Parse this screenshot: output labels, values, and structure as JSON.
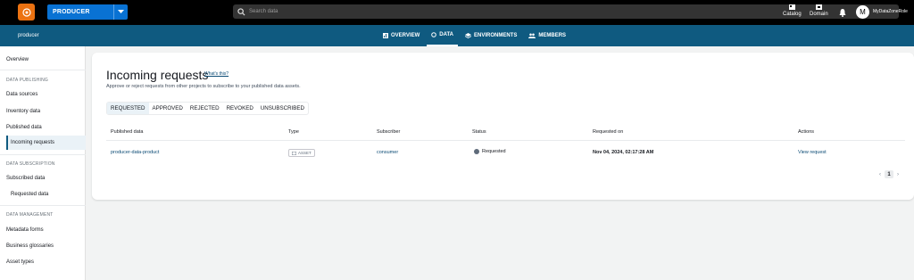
{
  "topbar": {
    "project": "PRODUCER",
    "search_placeholder": "Search data",
    "catalog_label": "Catalog",
    "domain_label": "Domain",
    "avatar_initial": "M",
    "role": "MyDataZoneRole"
  },
  "navbar": {
    "breadcrumb": "producer",
    "tabs": [
      {
        "label": "OVERVIEW",
        "icon": "overview-icon"
      },
      {
        "label": "DATA",
        "icon": "data-icon",
        "active": true
      },
      {
        "label": "ENVIRONMENTS",
        "icon": "environments-icon"
      },
      {
        "label": "MEMBERS",
        "icon": "members-icon"
      }
    ]
  },
  "sidebar": {
    "overview": "Overview",
    "section_publishing": "DATA PUBLISHING",
    "data_sources": "Data sources",
    "inventory": "Inventory data",
    "published": "Published data",
    "incoming": "Incoming requests",
    "section_subscription": "DATA SUBSCRIPTION",
    "subscribed": "Subscribed data",
    "requested": "Requested data",
    "section_management": "DATA MANAGEMENT",
    "metadata_forms": "Metadata forms",
    "glossaries": "Business glossaries",
    "asset_types": "Asset types"
  },
  "main": {
    "title": "Incoming requests",
    "whats_this": "What's this?",
    "description": "Approve or reject requests from other projects to subscribe to your published data assets.",
    "filters": [
      "REQUESTED",
      "APPROVED",
      "REJECTED",
      "REVOKED",
      "UNSUBSCRIBED"
    ],
    "columns": [
      "Published data",
      "Type",
      "Subscriber",
      "Status",
      "Requested on",
      "Actions"
    ],
    "row": {
      "published": "producer-data-product",
      "type": "ASSET",
      "subscriber": "consumer",
      "status": "Requested",
      "requested_on": "Nov 04, 2024, 02:17:28 AM",
      "action": "View request"
    },
    "page": "1"
  },
  "colors": {
    "accent": "#0972d3",
    "nav": "#0f5a80",
    "logo": "#ec7211"
  }
}
